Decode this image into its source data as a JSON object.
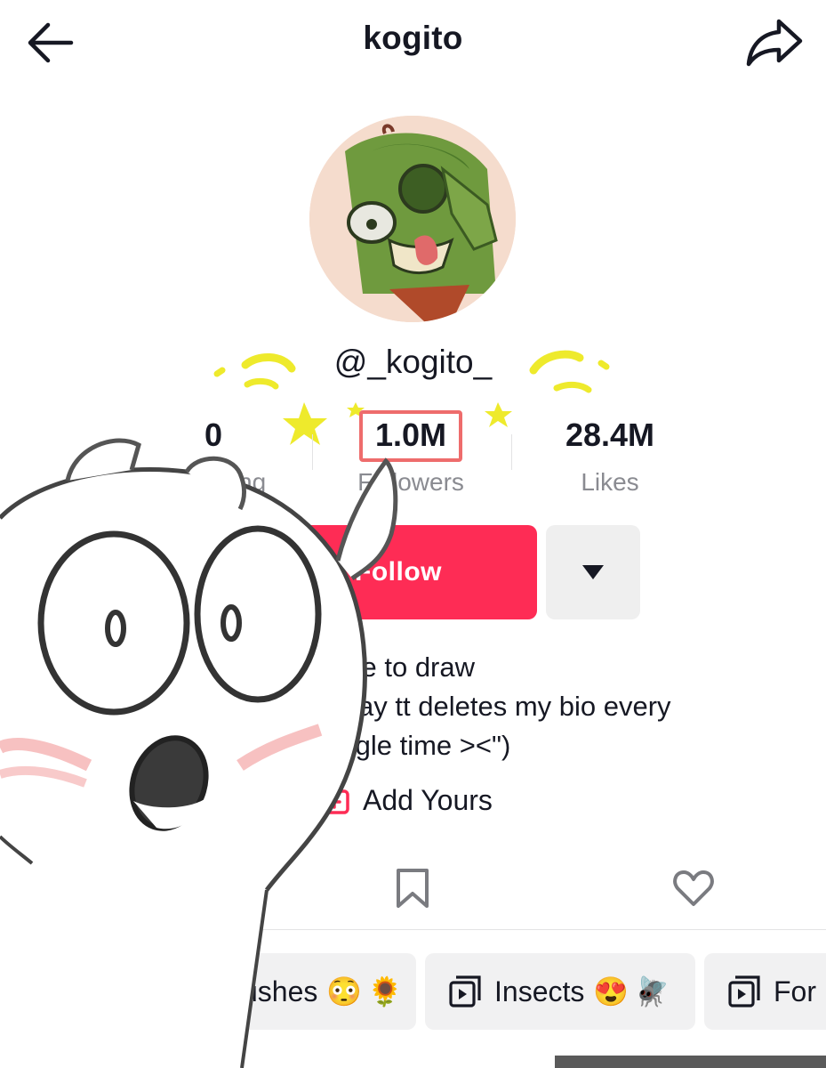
{
  "header": {
    "title": "kogito",
    "back_icon": "arrow-left-icon",
    "share_icon": "share-arrow-icon"
  },
  "profile": {
    "avatar_icon": "avatar-image",
    "username": "@_kogito_"
  },
  "stats": {
    "following": {
      "value": "0",
      "label": "Following"
    },
    "followers": {
      "value": "1.0M",
      "label": "Followers"
    },
    "likes": {
      "value": "28.4M",
      "label": "Likes"
    }
  },
  "actions": {
    "follow_label": "Follow",
    "more_icon": "caret-down-icon"
  },
  "bio": {
    "lines": [
      "I like to draw",
      "(I say tt deletes my bio every",
      "single time ><\")"
    ]
  },
  "add_yours": {
    "label": "Add Yours",
    "icon": "add-yours-icon"
  },
  "tabs": [
    {
      "icon": "bookmark-icon"
    },
    {
      "icon": "heart-icon"
    }
  ],
  "playlists": [
    {
      "label": "Brushes",
      "emoji": [
        "😳",
        "🌻"
      ]
    },
    {
      "label": "Insects",
      "emoji": [
        "😍",
        "🪰"
      ]
    },
    {
      "label": "For",
      "emoji": []
    }
  ],
  "colors": {
    "accent": "#fe2c55",
    "highlight": "#ee6c6c",
    "sparkle": "#eeea2c",
    "muted_text": "#8a8b91"
  }
}
